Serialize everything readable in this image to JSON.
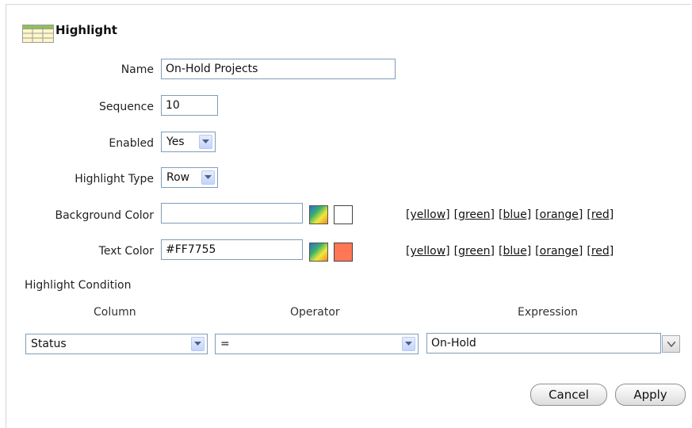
{
  "header": {
    "title": "Highlight",
    "icon": "table-icon"
  },
  "form": {
    "name_label": "Name",
    "name_value": "On-Hold Projects",
    "sequence_label": "Sequence",
    "sequence_value": "10",
    "enabled_label": "Enabled",
    "enabled_value": "Yes",
    "type_label": "Highlight Type",
    "type_value": "Row",
    "bg_label": "Background Color",
    "bg_value": "",
    "bg_swatch": "#ffffff",
    "text_label": "Text Color",
    "text_value": "#FF7755",
    "text_swatch": "#ff7755",
    "color_links": [
      "[yellow]",
      "[green]",
      "[blue]",
      "[orange]",
      "[red]"
    ]
  },
  "condition": {
    "title": "Highlight Condition",
    "column_header": "Column",
    "operator_header": "Operator",
    "expression_header": "Expression",
    "column_value": "Status",
    "operator_value": "=",
    "expression_value": "On-Hold"
  },
  "buttons": {
    "cancel": "Cancel",
    "apply": "Apply"
  }
}
